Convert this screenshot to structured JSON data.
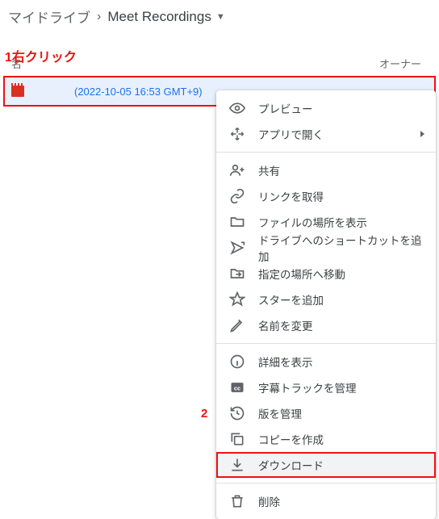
{
  "breadcrumb": {
    "root": "マイドライブ",
    "current": "Meet Recordings"
  },
  "columns": {
    "name": "名",
    "owner": "オーナー"
  },
  "annotations": {
    "step1_num": "1",
    "step1_text": "右クリック",
    "step2_num": "2"
  },
  "file": {
    "name": "(2022-10-05 16:53 GMT+9)"
  },
  "menu": {
    "preview": "プレビュー",
    "open_with": "アプリで開く",
    "share": "共有",
    "get_link": "リンクを取得",
    "show_location": "ファイルの場所を表示",
    "add_shortcut": "ドライブへのショートカットを追加",
    "move_to": "指定の場所へ移動",
    "add_star": "スターを追加",
    "rename": "名前を変更",
    "details": "詳細を表示",
    "captions": "字幕トラックを管理",
    "versions": "版を管理",
    "make_copy": "コピーを作成",
    "download": "ダウンロード",
    "delete": "削除"
  }
}
